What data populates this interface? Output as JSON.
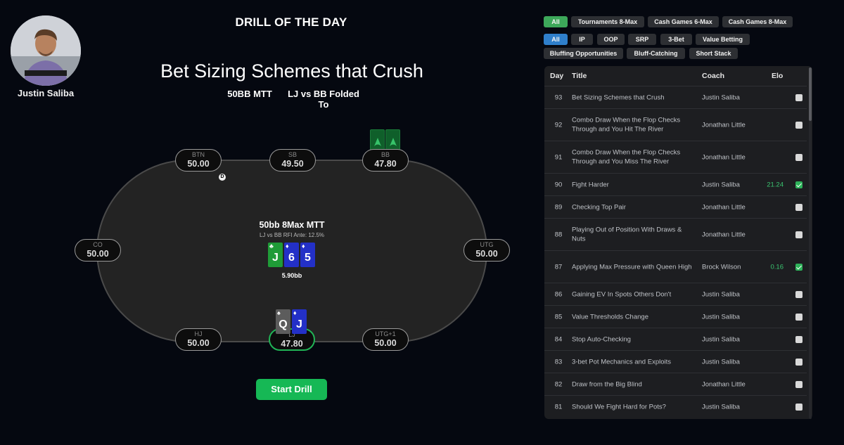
{
  "coach": {
    "name": "Justin Saliba"
  },
  "header": {
    "label": "DRILL OF THE DAY"
  },
  "drill": {
    "title": "Bet Sizing Schemes that Crush",
    "format": "50BB MTT",
    "situation": "LJ vs BB Folded To",
    "table_title": "50bb 8Max MTT",
    "table_subtitle": "LJ vs BB RFI Ante: 12.5%",
    "pot": "5.90bb",
    "dealer_label": "D",
    "start_label": "Start Drill"
  },
  "seats": {
    "btn": {
      "pos": "BTN",
      "stack": "50.00"
    },
    "sb": {
      "pos": "SB",
      "stack": "49.50"
    },
    "bb": {
      "pos": "BB",
      "stack": "47.80"
    },
    "co": {
      "pos": "CO",
      "stack": "50.00"
    },
    "utg": {
      "pos": "UTG",
      "stack": "50.00"
    },
    "hj": {
      "pos": "HJ",
      "stack": "50.00"
    },
    "lj": {
      "pos": "LJ",
      "stack": "47.80"
    },
    "utg1": {
      "pos": "UTG+1",
      "stack": "50.00"
    }
  },
  "board": [
    {
      "rank": "J",
      "suit": "♣",
      "color": "#1f9b37"
    },
    {
      "rank": "6",
      "suit": "♦",
      "color": "#2330c7"
    },
    {
      "rank": "5",
      "suit": "♦",
      "color": "#2330c7"
    }
  ],
  "hero_hand": [
    {
      "rank": "Q",
      "suit": "♠",
      "color": "#5c5c5c"
    },
    {
      "rank": "J",
      "suit": "♦",
      "color": "#2330c7"
    }
  ],
  "filters": {
    "game_types": [
      "All",
      "Tournaments 8-Max",
      "Cash Games 6-Max",
      "Cash Games 8-Max"
    ],
    "tags_row1": [
      "All",
      "IP",
      "OOP",
      "SRP",
      "3-Bet",
      "Value Betting"
    ],
    "tags_row2": [
      "Bluffing Opportunities",
      "Bluff-Catching",
      "Short Stack"
    ]
  },
  "list": {
    "headers": {
      "day": "Day",
      "title": "Title",
      "coach": "Coach",
      "elo": "Elo"
    },
    "rows": [
      {
        "day": "93",
        "title": "Bet Sizing Schemes that Crush",
        "coach": "Justin Saliba",
        "elo": "",
        "done": false
      },
      {
        "day": "92",
        "title": "Combo Draw When the Flop Checks Through and You Hit The River",
        "coach": "Jonathan Little",
        "elo": "",
        "done": false
      },
      {
        "day": "91",
        "title": "Combo Draw When the Flop Checks Through and You Miss The River",
        "coach": "Jonathan Little",
        "elo": "",
        "done": false
      },
      {
        "day": "90",
        "title": "Fight Harder",
        "coach": "Justin Saliba",
        "elo": "21.24",
        "done": true
      },
      {
        "day": "89",
        "title": "Checking Top Pair",
        "coach": "Jonathan Little",
        "elo": "",
        "done": false
      },
      {
        "day": "88",
        "title": "Playing Out of Position With Draws & Nuts",
        "coach": "Jonathan Little",
        "elo": "",
        "done": false
      },
      {
        "day": "87",
        "title": "Applying Max Pressure with Queen High",
        "coach": "Brock Wilson",
        "elo": "0.16",
        "done": true
      },
      {
        "day": "86",
        "title": "Gaining EV In Spots Others Don't",
        "coach": "Justin Saliba",
        "elo": "",
        "done": false
      },
      {
        "day": "85",
        "title": "Value Thresholds Change",
        "coach": "Justin Saliba",
        "elo": "",
        "done": false
      },
      {
        "day": "84",
        "title": "Stop Auto-Checking",
        "coach": "Justin Saliba",
        "elo": "",
        "done": false
      },
      {
        "day": "83",
        "title": "3-bet Pot Mechanics and Exploits",
        "coach": "Justin Saliba",
        "elo": "",
        "done": false
      },
      {
        "day": "82",
        "title": "Draw from the Big Blind",
        "coach": "Jonathan Little",
        "elo": "",
        "done": false
      },
      {
        "day": "81",
        "title": "Should We Fight Hard for Pots?",
        "coach": "Justin Saliba",
        "elo": "",
        "done": false
      }
    ]
  }
}
